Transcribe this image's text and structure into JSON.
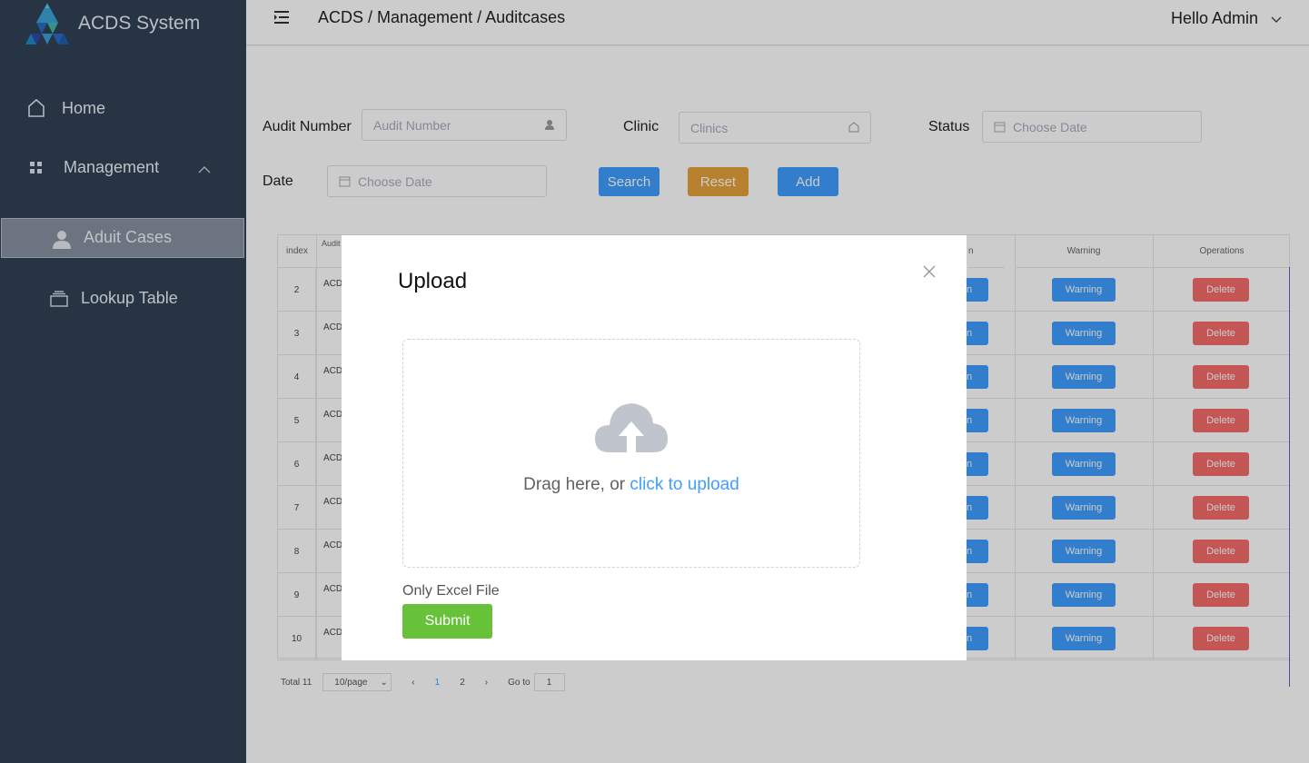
{
  "app": {
    "title": "ACDS System"
  },
  "sidebar": {
    "items": [
      {
        "label": "Home",
        "icon": "home-icon"
      },
      {
        "label": "Management",
        "icon": "grid-icon"
      },
      {
        "label": "Aduit Cases",
        "icon": "user-icon",
        "active": true
      },
      {
        "label": "Lookup Table",
        "icon": "layers-icon"
      }
    ]
  },
  "header": {
    "breadcrumb": "ACDS / Management / Auditcases",
    "greeting": "Hello Admin"
  },
  "filters": {
    "audit_number_label": "Audit Number",
    "audit_number_placeholder": "Audit Number",
    "clinic_label": "Clinic",
    "clinic_placeholder": "Clinics",
    "status_label": "Status",
    "status_placeholder": "Choose Date",
    "date_label": "Date",
    "date_placeholder": "Choose Date",
    "search_label": "Search",
    "reset_label": "Reset",
    "add_label": "Add"
  },
  "table": {
    "columns": {
      "index": "index",
      "audit": "Audit",
      "edit_partial": "n",
      "warning": "Warning",
      "operations": "Operations"
    },
    "rows": [
      {
        "index": "2",
        "code": "ACD",
        "edit": "n",
        "warning": "Warning",
        "delete": "Delete"
      },
      {
        "index": "3",
        "code": "ACD",
        "edit": "n",
        "warning": "Warning",
        "delete": "Delete"
      },
      {
        "index": "4",
        "code": "ACD",
        "edit": "n",
        "warning": "Warning",
        "delete": "Delete"
      },
      {
        "index": "5",
        "code": "ACD",
        "edit": "n",
        "warning": "Warning",
        "delete": "Delete"
      },
      {
        "index": "6",
        "code": "ACD",
        "edit": "n",
        "warning": "Warning",
        "delete": "Delete"
      },
      {
        "index": "7",
        "code": "ACD",
        "edit": "n",
        "warning": "Warning",
        "delete": "Delete"
      },
      {
        "index": "8",
        "code": "ACD",
        "edit": "n",
        "warning": "Warning",
        "delete": "Delete"
      },
      {
        "index": "9",
        "code": "ACD",
        "edit": "n",
        "warning": "Warning",
        "delete": "Delete"
      },
      {
        "index": "10",
        "code": "ACD",
        "edit": "n",
        "warning": "Warning",
        "delete": "Delete"
      }
    ]
  },
  "pagination": {
    "total": "Total 11",
    "page_size": "10/page",
    "pages": [
      "1",
      "2"
    ],
    "current": "1",
    "goto_label": "Go to",
    "goto_value": "1"
  },
  "dialog": {
    "title": "Upload",
    "drag_text": "Drag here, or ",
    "click_text": "click to upload",
    "tip": "Only Excel File",
    "submit_label": "Submit"
  },
  "colors": {
    "sidebar_bg": "#304156",
    "primary": "#409eff",
    "warning": "#e6a23c",
    "danger": "#f56c6c",
    "success": "#67c23a"
  }
}
